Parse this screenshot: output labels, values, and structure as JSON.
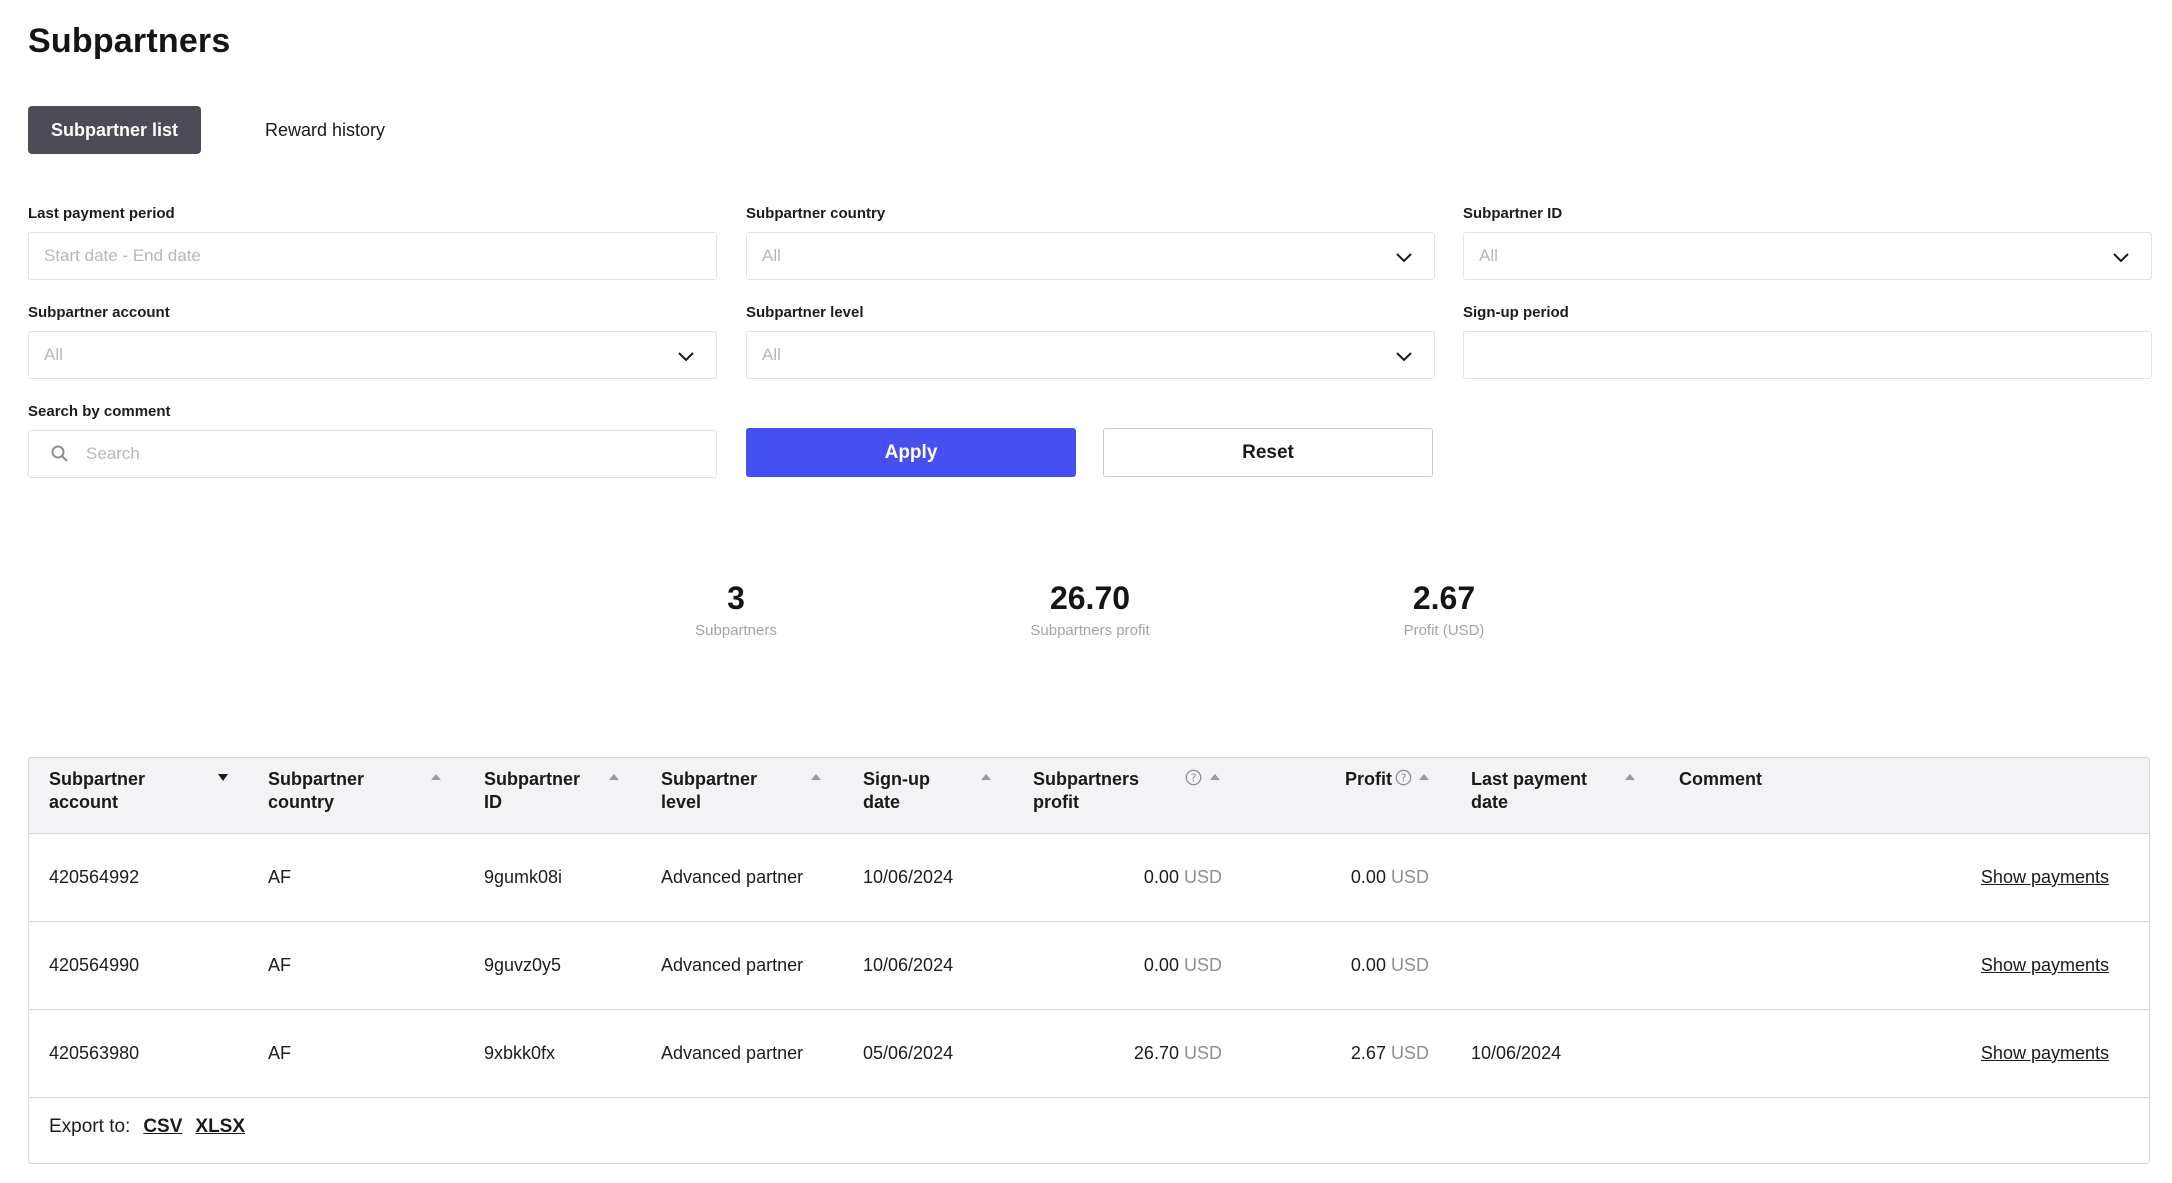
{
  "page": {
    "title": "Subpartners"
  },
  "tabs": [
    {
      "label": "Subpartner list",
      "active": true
    },
    {
      "label": "Reward history",
      "active": false
    }
  ],
  "filters": {
    "last_payment_period": {
      "label": "Last payment period",
      "placeholder": "Start date - End date"
    },
    "subpartner_country": {
      "label": "Subpartner country",
      "value": "All"
    },
    "subpartner_id": {
      "label": "Subpartner ID",
      "value": "All"
    },
    "subpartner_account": {
      "label": "Subpartner account",
      "value": "All"
    },
    "subpartner_level": {
      "label": "Subpartner level",
      "value": "All"
    },
    "signup_period": {
      "label": "Sign-up period",
      "value": ""
    },
    "search_comment": {
      "label": "Search by comment",
      "placeholder": "Search"
    }
  },
  "actions": {
    "apply_label": "Apply",
    "reset_label": "Reset"
  },
  "stats": [
    {
      "value": "3",
      "label": "Subpartners"
    },
    {
      "value": "26.70",
      "label": "Subpartners profit"
    },
    {
      "value": "2.67",
      "label": "Profit (USD)"
    }
  ],
  "table": {
    "columns": [
      "Subpartner\naccount",
      "Subpartner\ncountry",
      "Subpartner\nID",
      "Subpartner\nlevel",
      "Sign-up\ndate",
      "Subpartners\nprofit",
      "Profit",
      "Last payment\ndate",
      "Comment"
    ],
    "rows": [
      {
        "account": "420564992",
        "country": "AF",
        "id": "9gumk08i",
        "level": "Advanced partner",
        "signup": "10/06/2024",
        "sub_profit": "0.00",
        "profit": "0.00",
        "currency": "USD",
        "last_payment": "",
        "comment": "",
        "action": "Show payments"
      },
      {
        "account": "420564990",
        "country": "AF",
        "id": "9guvz0y5",
        "level": "Advanced partner",
        "signup": "10/06/2024",
        "sub_profit": "0.00",
        "profit": "0.00",
        "currency": "USD",
        "last_payment": "",
        "comment": "",
        "action": "Show payments"
      },
      {
        "account": "420563980",
        "country": "AF",
        "id": "9xbkk0fx",
        "level": "Advanced partner",
        "signup": "05/06/2024",
        "sub_profit": "26.70",
        "profit": "2.67",
        "currency": "USD",
        "last_payment": "10/06/2024",
        "comment": "",
        "action": "Show payments"
      }
    ]
  },
  "export": {
    "label": "Export to:",
    "formats": [
      "CSV",
      "XLSX"
    ]
  },
  "colors": {
    "accent": "#4650f0",
    "active_tab": "#4d4b55",
    "muted": "#a3a3a8"
  }
}
